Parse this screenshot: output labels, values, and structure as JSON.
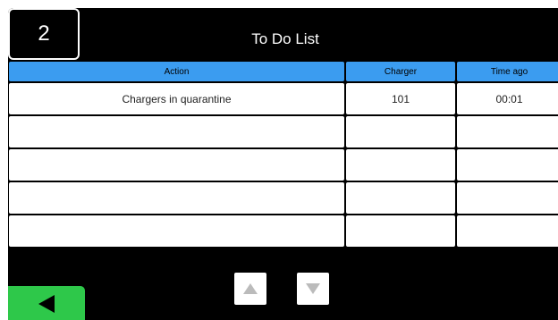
{
  "header": {
    "page_number": "2",
    "title": "To Do List"
  },
  "table": {
    "columns": [
      "Action",
      "Charger",
      "Time ago"
    ],
    "rows": [
      {
        "action": "Chargers in quarantine",
        "charger": "101",
        "time_ago": "00:01"
      },
      {
        "action": "",
        "charger": "",
        "time_ago": ""
      },
      {
        "action": "",
        "charger": "",
        "time_ago": ""
      },
      {
        "action": "",
        "charger": "",
        "time_ago": ""
      },
      {
        "action": "",
        "charger": "",
        "time_ago": ""
      }
    ]
  },
  "navigation": {
    "scroll_up_icon": "triangle-up-icon",
    "scroll_down_icon": "triangle-down-icon",
    "back_icon": "triangle-left-icon"
  },
  "colors": {
    "background": "#000000",
    "header_blue": "#3b9cf0",
    "back_green": "#2ec84a",
    "arrow_disabled": "#bbbbbb"
  }
}
